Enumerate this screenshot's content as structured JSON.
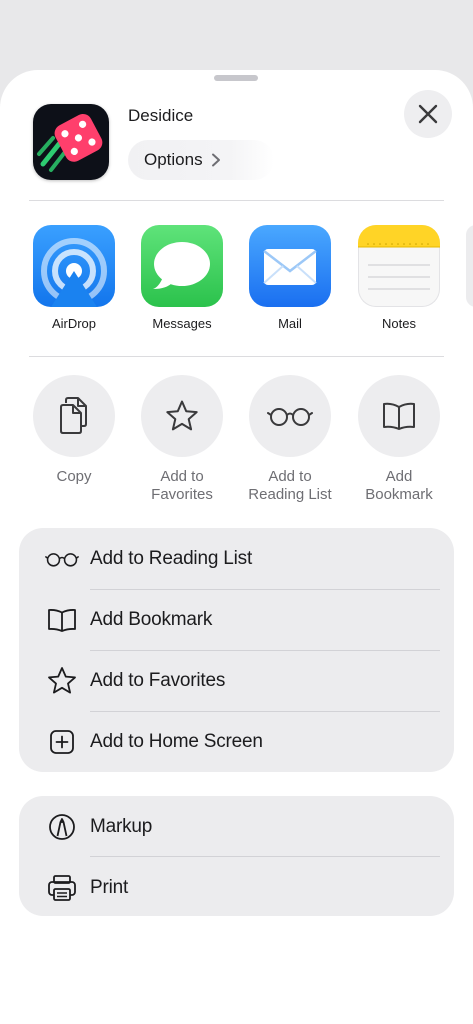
{
  "header": {
    "app_name": "Desidice",
    "options_label": "Options",
    "app_icon": "dice-app-icon",
    "close_icon": "close-icon"
  },
  "share_targets": [
    {
      "label": "AirDrop",
      "icon": "airdrop-icon",
      "color": "#1f8bf4"
    },
    {
      "label": "Messages",
      "icon": "messages-icon",
      "color": "#34c759"
    },
    {
      "label": "Mail",
      "icon": "mail-icon",
      "color": "#1a7ff5"
    },
    {
      "label": "Notes",
      "icon": "notes-icon",
      "color": "#ffd426"
    }
  ],
  "actions": [
    {
      "label": "Copy",
      "icon": "copy-icon"
    },
    {
      "label": "Add to\nFavorites",
      "icon": "star-icon"
    },
    {
      "label": "Add to\nReading List",
      "icon": "glasses-icon"
    },
    {
      "label": "Add\nBookmark",
      "icon": "book-icon"
    }
  ],
  "list_primary": [
    {
      "label": "Add to Reading List",
      "icon": "glasses-icon"
    },
    {
      "label": "Add Bookmark",
      "icon": "book-icon"
    },
    {
      "label": "Add to Favorites",
      "icon": "star-icon"
    },
    {
      "label": "Add to Home Screen",
      "icon": "plus-square-icon"
    }
  ],
  "list_secondary": [
    {
      "label": "Markup",
      "icon": "markup-pen-icon"
    },
    {
      "label": "Print",
      "icon": "printer-icon"
    }
  ]
}
